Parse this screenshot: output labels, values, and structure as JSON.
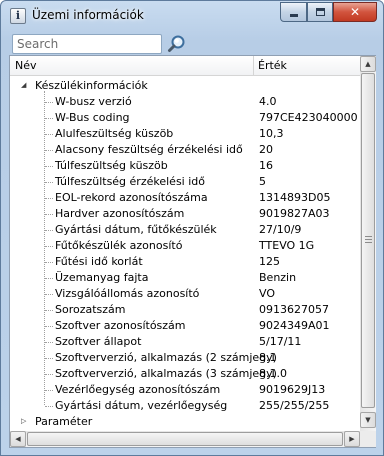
{
  "window": {
    "title": "Üzemi információk",
    "icon": "info-i-icon"
  },
  "search": {
    "placeholder": "Search",
    "value": ""
  },
  "columns": {
    "name": "Név",
    "value": "Érték"
  },
  "tree": {
    "group1_label": "Készülékinformációk",
    "group2_label": "Paraméter",
    "items": [
      {
        "label": "W-busz verzió",
        "value": "4.0"
      },
      {
        "label": "W-Bus coding",
        "value": "797CE423040000"
      },
      {
        "label": "Alulfeszültség küszöb",
        "value": "10,3"
      },
      {
        "label": "Alacsony feszültség érzékelési idő",
        "value": "20"
      },
      {
        "label": "Túlfeszültség küszöb",
        "value": "16"
      },
      {
        "label": "Túlfeszültség érzékelési idő",
        "value": "5"
      },
      {
        "label": "EOL-rekord azonosítószáma",
        "value": "1314893D05"
      },
      {
        "label": "Hardver azonosítószám",
        "value": "9019827A03"
      },
      {
        "label": "Gyártási dátum, fűtőkészülék",
        "value": "27/10/9"
      },
      {
        "label": "Fűtőkészülék azonosító",
        "value": "TTEVO 1G"
      },
      {
        "label": "Fűtési idő korlát",
        "value": "125"
      },
      {
        "label": "Üzemanyag fajta",
        "value": "Benzin"
      },
      {
        "label": "Vizsgálóállomás azonosító",
        "value": "VO"
      },
      {
        "label": "Sorozatszám",
        "value": "0913627057"
      },
      {
        "label": "Szoftver azonosítószám",
        "value": "9024349A01"
      },
      {
        "label": "Szoftver állapot",
        "value": "5/17/11"
      },
      {
        "label": "Szoftververzió, alkalmazás (2 számjegy)",
        "value": "8.1"
      },
      {
        "label": "Szoftververzió, alkalmazás (3 számjegy)",
        "value": "8.1.0"
      },
      {
        "label": "Vezérlőegység azonosítószám",
        "value": "9019629J13"
      },
      {
        "label": "Gyártási dátum, vezérlőegység",
        "value": "255/255/255"
      }
    ]
  },
  "colors": {
    "window_frame": "#bcd2ea",
    "close_button": "#c13a22"
  }
}
